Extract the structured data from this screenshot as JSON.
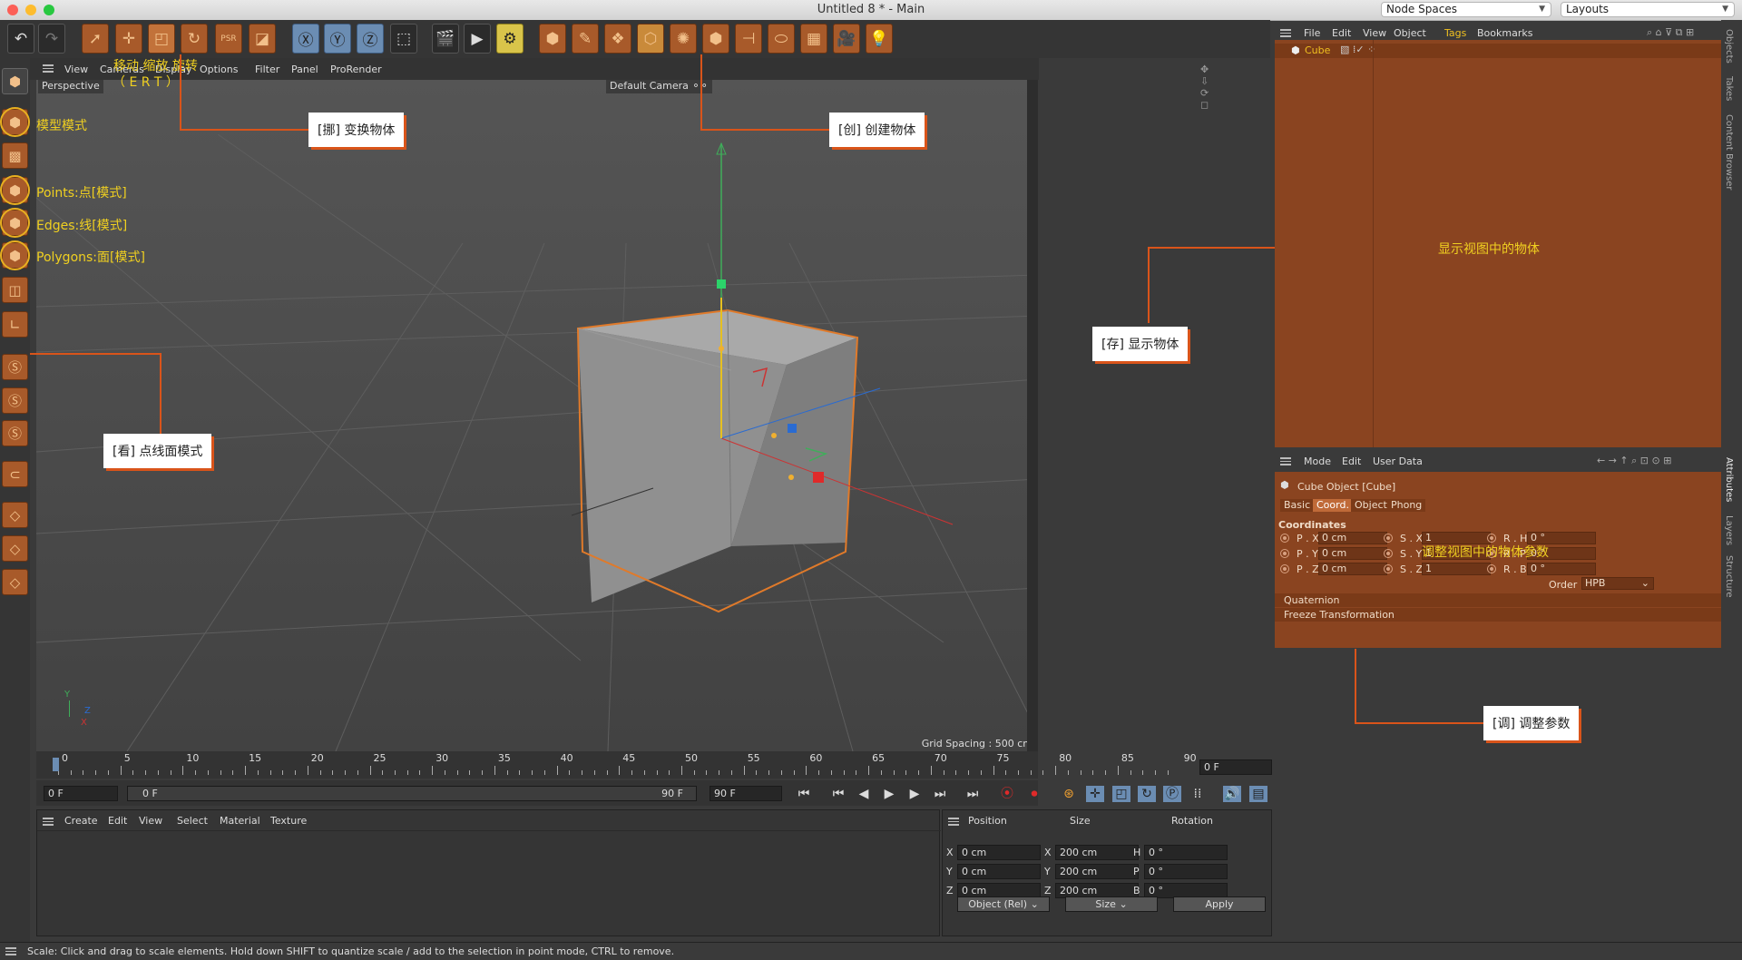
{
  "window": {
    "title": "Untitled 8 * - Main",
    "node_spaces": "Node Spaces",
    "layouts": "Layouts"
  },
  "viewport": {
    "menu": [
      "View",
      "Cameras",
      "Display",
      "Options",
      "Filter",
      "Panel",
      "ProRender"
    ],
    "projection": "Perspective",
    "camera": "Default Camera",
    "grid_spacing": "Grid Spacing : 500 cm"
  },
  "annotations": {
    "move_scale_rotate": "移动 缩放 旋转",
    "keys": "（ E    R    T ）",
    "model_mode": "模型模式",
    "points": "Points:点[模式]",
    "edges": "Edges:线[模式]",
    "polygons": "Polygons:面[模式]",
    "transform": "[挪] 变换物体",
    "create": "[创] 创建物体",
    "show_objects": "显示视图中的物体",
    "store": "[存] 显示物体",
    "look": "[看] 点线面模式",
    "adjust_params_label": "调整视图中的物体参数",
    "adjust": "[调] 调整参数"
  },
  "timeline": {
    "ticks": [
      "0",
      "5",
      "10",
      "15",
      "20",
      "25",
      "30",
      "35",
      "40",
      "45",
      "50",
      "55",
      "60",
      "65",
      "70",
      "75",
      "80",
      "85",
      "90"
    ],
    "current": "0 F",
    "start": "0 F",
    "range_start": "0 F",
    "range_end": "90 F",
    "end": "90 F"
  },
  "material_menu": [
    "Create",
    "Edit",
    "View",
    "Select",
    "Material",
    "Texture"
  ],
  "coord_manager": {
    "headers": [
      "Position",
      "Size",
      "Rotation"
    ],
    "rows": [
      {
        "axis": "X",
        "pos": "0 cm",
        "saxis": "X",
        "size": "200 cm",
        "raxis": "H",
        "rot": "0 °"
      },
      {
        "axis": "Y",
        "pos": "0 cm",
        "saxis": "Y",
        "size": "200 cm",
        "raxis": "P",
        "rot": "0 °"
      },
      {
        "axis": "Z",
        "pos": "0 cm",
        "saxis": "Z",
        "size": "200 cm",
        "raxis": "B",
        "rot": "0 °"
      }
    ],
    "mode": "Object (Rel)",
    "size_mode": "Size",
    "apply": "Apply"
  },
  "object_manager": {
    "menu": [
      "File",
      "Edit",
      "View",
      "Object",
      "Tags",
      "Bookmarks"
    ],
    "object": "Cube"
  },
  "attributes": {
    "menu": [
      "Mode",
      "Edit",
      "User Data"
    ],
    "title": "Cube Object [Cube]",
    "tabs": [
      "Basic",
      "Coord.",
      "Object",
      "Phong"
    ],
    "section": "Coordinates",
    "rows": [
      {
        "p": "P . X",
        "pv": "0 cm",
        "s": "S . X",
        "sv": "1",
        "r": "R . H",
        "rv": "0 °"
      },
      {
        "p": "P . Y",
        "pv": "0 cm",
        "s": "S . Y",
        "sv": "1",
        "r": "R . P",
        "rv": "0 °"
      },
      {
        "p": "P . Z",
        "pv": "0 cm",
        "s": "S . Z",
        "sv": "1",
        "r": "R . B",
        "rv": "0 °"
      }
    ],
    "order_label": "Order",
    "order": "HPB",
    "quaternion": "Quaternion",
    "freeze": "Freeze Transformation"
  },
  "right_tabs": [
    "Objects",
    "Takes",
    "Content Browser",
    "Attributes",
    "Layers",
    "Structure"
  ],
  "status": "Scale: Click and drag to scale elements. Hold down SHIFT to quantize scale / add to the selection in point mode, CTRL to remove.",
  "axis_labels": {
    "y": "Y",
    "z": "Z",
    "x": "X"
  }
}
